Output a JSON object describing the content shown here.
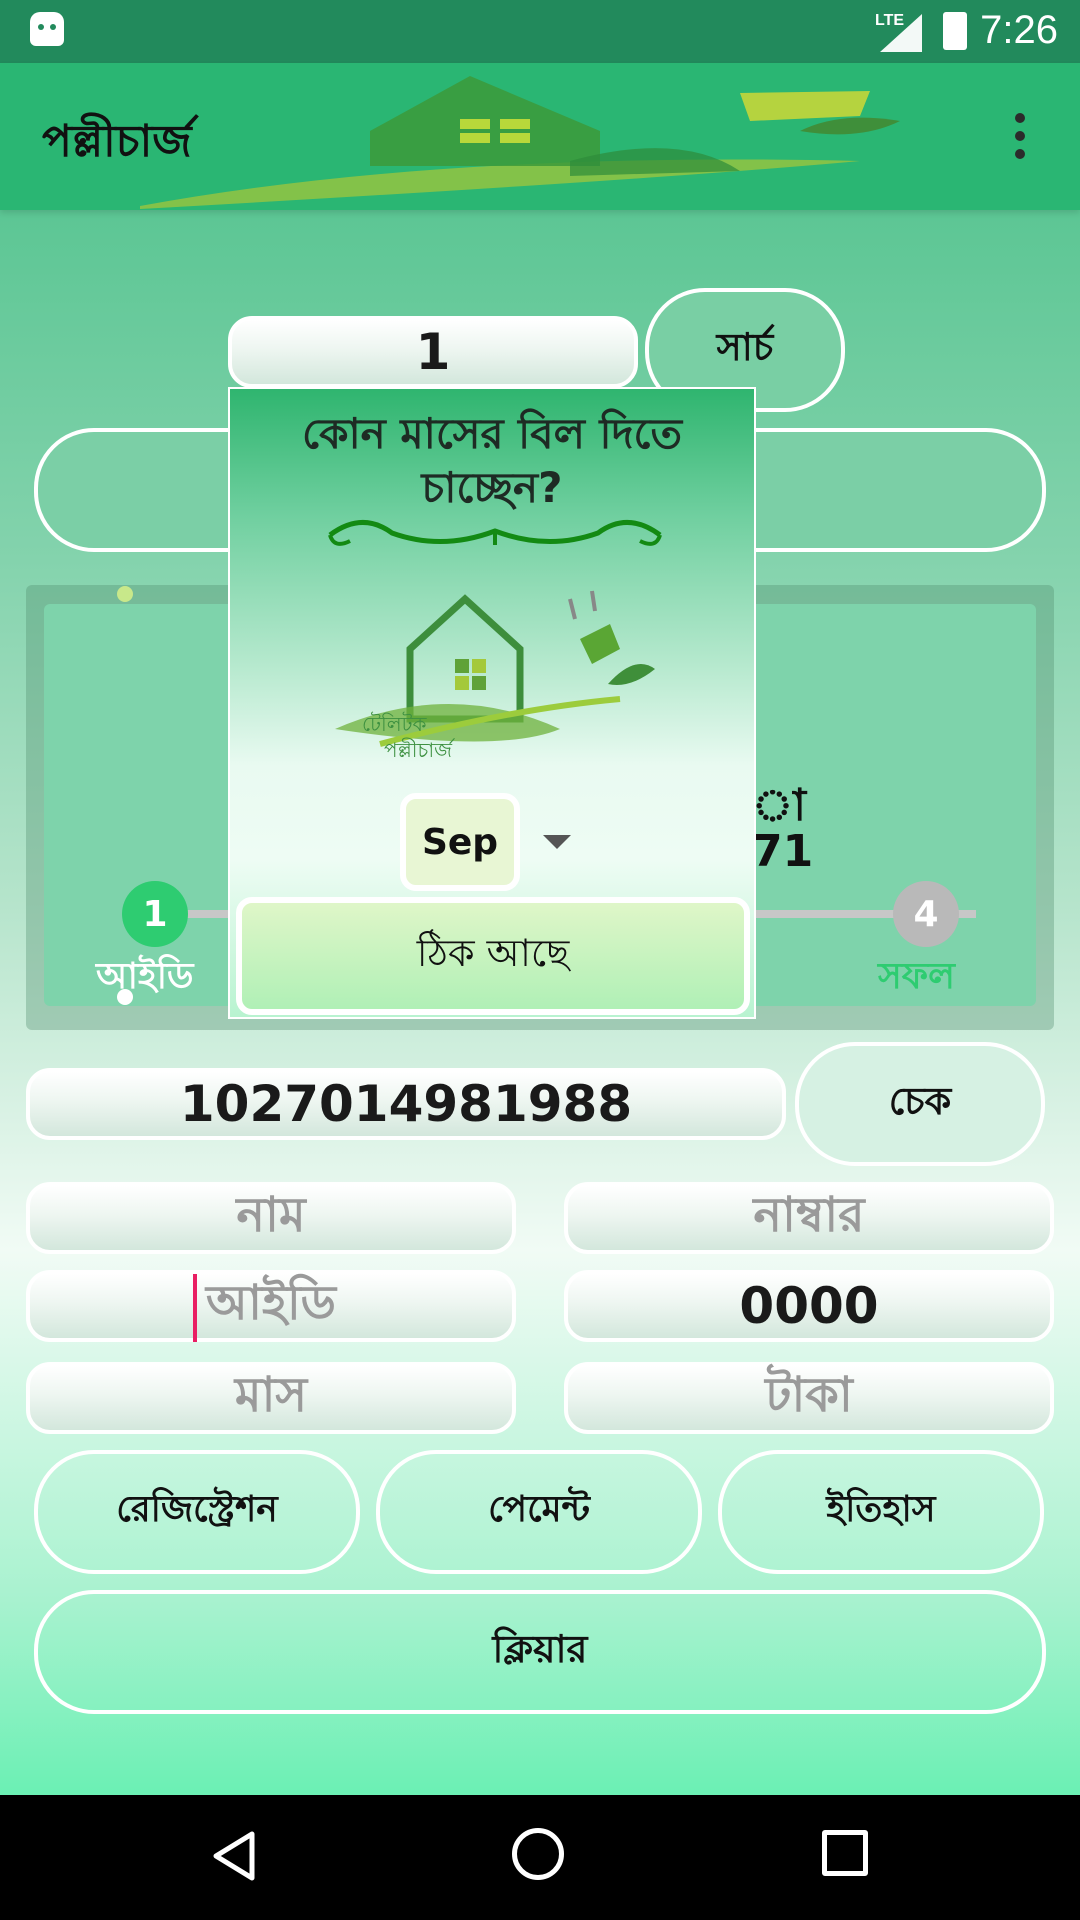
{
  "status_bar": {
    "time": "7:26",
    "network": "LTE"
  },
  "app_bar": {
    "title": "পল্লীচার্জ"
  },
  "search": {
    "value": "1",
    "button": "সার্চ"
  },
  "stepper": {
    "step1_number": "1",
    "step1_label": "আইডি",
    "step4_number": "4",
    "step4_label": "সফল",
    "partial_text_1": "া",
    "partial_text_2": "71"
  },
  "dialog": {
    "title_line1": "কোন মাসের বিল দিতে",
    "title_line2": "চাচ্ছেন?",
    "logo_text1": "টেলিটক",
    "logo_text2": "পল্লীচার্জ",
    "selected_month": "Sep",
    "ok_button": "ঠিক আছে"
  },
  "account": {
    "value": "1027014981988",
    "check_button": "চেক"
  },
  "form": {
    "name_placeholder": "নাম",
    "number_placeholder": "নাম্বার",
    "id_placeholder": "আইডি",
    "pin_value": "0000",
    "month_placeholder": "মাস",
    "amount_placeholder": "টাকা"
  },
  "actions": {
    "registration": "রেজিস্ট্রেশন",
    "payment": "পেমেন্ট",
    "history": "ইতিহাস",
    "clear": "ক্লিয়ার"
  },
  "colors": {
    "primary": "#2ab673",
    "status_bar": "#228a5c",
    "step_active": "#2ecc71",
    "step_inactive": "#b9b9b9"
  }
}
